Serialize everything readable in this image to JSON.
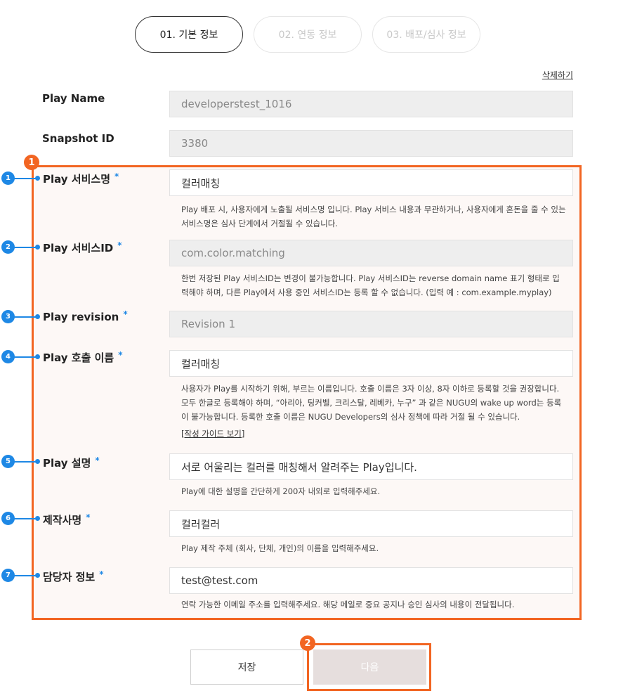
{
  "steps": [
    {
      "label": "01. 기본 정보",
      "active": true
    },
    {
      "label": "02. 연동 정보",
      "active": false
    },
    {
      "label": "03. 배포/심사 정보",
      "active": false
    }
  ],
  "delete_link": "삭제하기",
  "play_name": {
    "label": "Play Name",
    "value": "developerstest_1016"
  },
  "snapshot_id": {
    "label": "Snapshot ID",
    "value": "3380"
  },
  "service_name": {
    "marker": "1",
    "label": "Play 서비스명",
    "required": "*",
    "value": "컬러매칭",
    "help": "Play 배포 시, 사용자에게 노출될 서비스명 입니다. Play 서비스 내용과 무관하거나, 사용자에게 혼돈을 줄 수 있는 서비스명은 심사 단계에서 거절될 수 있습니다."
  },
  "service_id": {
    "marker": "2",
    "label": "Play 서비스ID",
    "required": "*",
    "value": "com.color.matching",
    "help": "한번 저장된 Play 서비스ID는 변경이 불가능합니다. Play 서비스ID는 reverse domain name 표기 형태로 입력해야 하며, 다른 Play에서 사용 중인 서비스ID는 등록 할 수 없습니다. (입력 예 : com.example.myplay)"
  },
  "revision": {
    "marker": "3",
    "label": "Play revision",
    "required": "*",
    "value": "Revision 1"
  },
  "invocation_name": {
    "marker": "4",
    "label": "Play 호출 이름",
    "required": "*",
    "value": "컬러매칭",
    "help": "사용자가 Play를 시작하기 위해, 부르는 이름입니다. 호출 이름은 3자 이상, 8자 이하로 등록할 것을 권장합니다. 모두 한글로 등록해야 하며, “아리아, 팅커벨, 크리스탈, 레베카, 누구” 과 같은 NUGU의 wake up word는 등록이 불가능합니다. 등록한 호출 이름은 NUGU Developers의 심사 정책에 따라 거절 될 수 있습니다.",
    "guide_link": "[작성 가이드 보기]"
  },
  "description": {
    "marker": "5",
    "label": "Play 설명",
    "required": "*",
    "value": "서로 어울리는 컬러를 매칭해서 알려주는 Play입니다.",
    "help": "Play에 대한 설명을 간단하게 200자 내외로 입력해주세요."
  },
  "maker": {
    "marker": "6",
    "label": "제작사명",
    "required": "*",
    "value": "컬러컬러",
    "help": "Play 제작 주체 (회사, 단체, 개인)의 이름을 입력해주세요."
  },
  "contact": {
    "marker": "7",
    "label": "담당자 정보",
    "required": "*",
    "value": "test@test.com",
    "help": "연락 가능한 이메일 주소를 입력해주세요. 해당 메일로 중요 공지나 승인 심사의 내용이 전달됩니다."
  },
  "callouts": {
    "box_badge": "1",
    "next_badge": "2"
  },
  "buttons": {
    "save": "저장",
    "next": "다음"
  },
  "colors": {
    "accent": "#f26522",
    "marker": "#1e88e5",
    "disabled_field": "#eeeeee"
  }
}
